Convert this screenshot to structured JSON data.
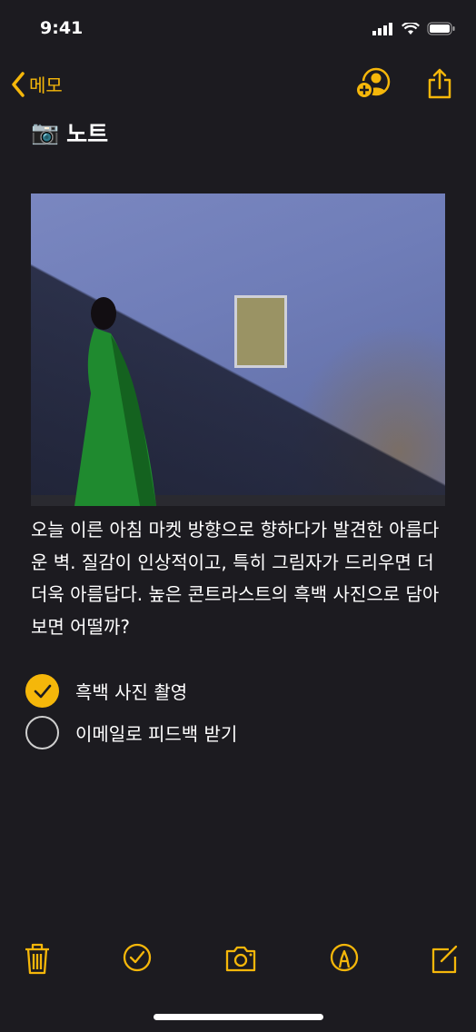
{
  "status": {
    "time": "9:41"
  },
  "nav": {
    "back_label": "메모"
  },
  "note": {
    "title_emoji": "📷",
    "title": "노트",
    "body": "오늘 이른 아침 마켓 방향으로 향하다가 발견한 아름다운 벽. 질감이 인상적이고, 특히 그림자가 드리우면 더더욱 아름답다. 높은 콘트라스트의 흑백 사진으로 담아보면 어떨까?",
    "checklist": [
      {
        "label": "흑백 사진 촬영",
        "checked": true
      },
      {
        "label": "이메일로 피드백 받기",
        "checked": false
      }
    ]
  },
  "colors": {
    "accent": "#f5b70a",
    "background": "#1c1b20"
  }
}
